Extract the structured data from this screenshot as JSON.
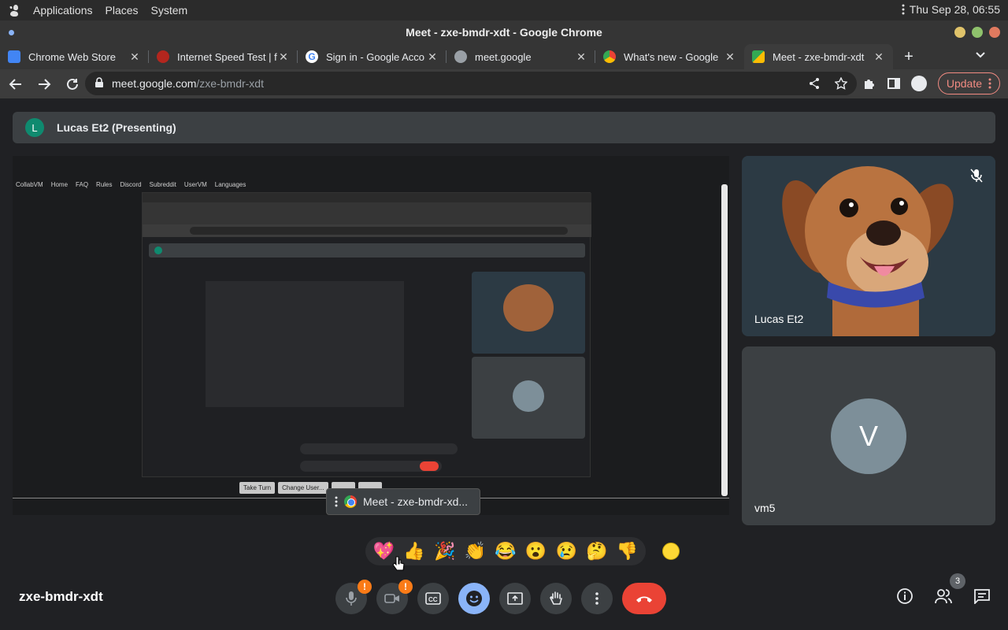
{
  "desktop": {
    "menus": [
      "Applications",
      "Places",
      "System"
    ],
    "clock": "Thu Sep 28, 06:55"
  },
  "window": {
    "title": "Meet - zxe-bmdr-xdt - Google Chrome"
  },
  "tabs": [
    {
      "label": "Chrome Web Store",
      "favicon_color": "#4285f4"
    },
    {
      "label": "Internet Speed Test | f",
      "favicon_color": "#b3261e"
    },
    {
      "label": "Sign in - Google Acco",
      "favicon_color": "#ffffff"
    },
    {
      "label": "meet.google",
      "favicon_color": "#9aa0a6"
    },
    {
      "label": "What's new - Google",
      "favicon_color": "#fbbc04"
    },
    {
      "label": "Meet - zxe-bmdr-xdt",
      "favicon_color": "#34a853"
    }
  ],
  "toolbar": {
    "url_host": "meet.google.com",
    "url_path": "/zxe-bmdr-xdt",
    "update_label": "Update"
  },
  "meet": {
    "presenter_initial": "L",
    "presenter_banner": "Lucas Et2 (Presenting)",
    "window_tooltip": "Meet - zxe-bmdr-xd...",
    "participants": [
      {
        "name": "Lucas Et2"
      },
      {
        "name": "vm5",
        "initial": "V"
      }
    ],
    "reactions": [
      "💖",
      "👍",
      "🎉",
      "👏",
      "😂",
      "😮",
      "😢",
      "🤔",
      "👎"
    ],
    "meeting_code": "zxe-bmdr-xdt",
    "participant_count": "3",
    "warning_badge": "!"
  },
  "shared_screen": {
    "nav": [
      "CollabVM",
      "Home",
      "FAQ",
      "Rules",
      "Discord",
      "Subreddit",
      "UserVM",
      "Languages"
    ],
    "bottom_buttons": [
      "Take Turn",
      "Change User..."
    ]
  },
  "colors": {
    "meet_bg": "#202124",
    "tile_bg": "#3c4043",
    "accent_blue": "#8ab4f8",
    "end_call_red": "#ea4335"
  }
}
